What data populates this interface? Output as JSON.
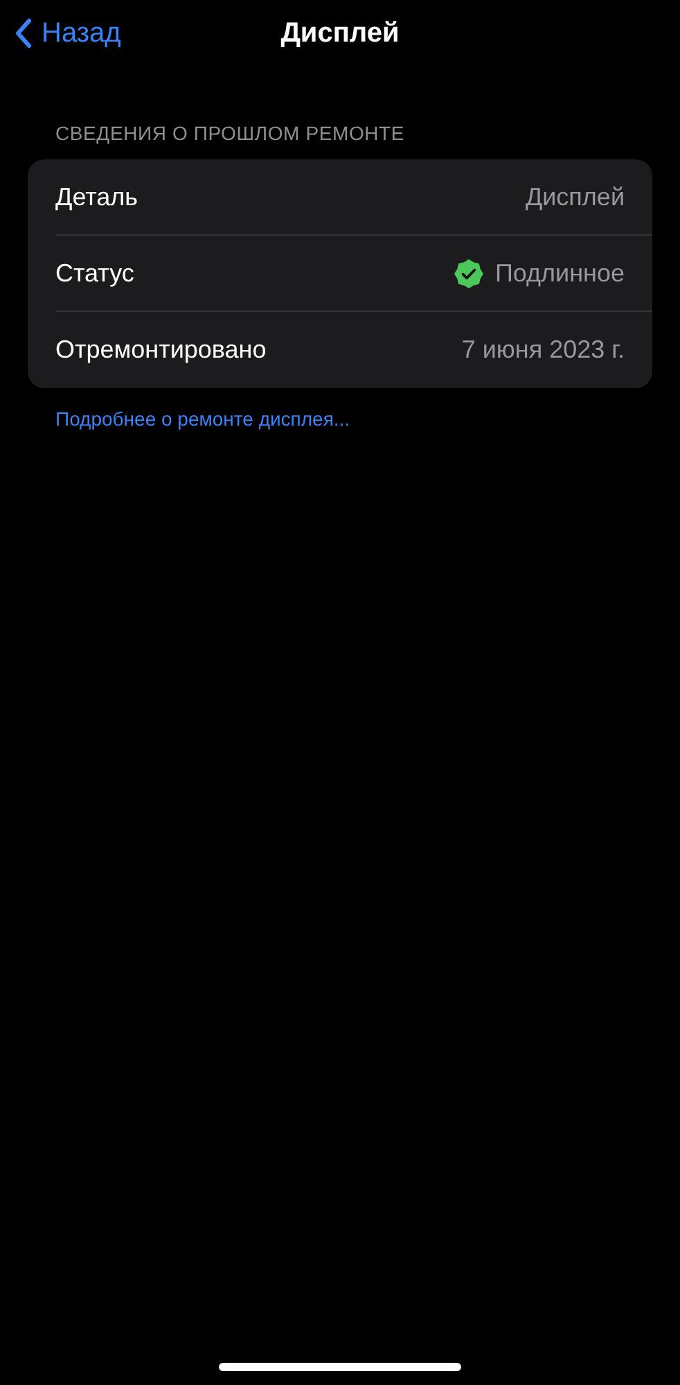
{
  "nav": {
    "back": "Назад",
    "title": "Дисплей"
  },
  "section": {
    "header": "СВЕДЕНИЯ О ПРОШЛОМ РЕМОНТЕ",
    "rows": [
      {
        "kind": "text",
        "label": "Деталь",
        "value": "Дисплей"
      },
      {
        "kind": "verified",
        "label": "Статус",
        "value": "Подлинное"
      },
      {
        "kind": "text",
        "label": "Отремонтировано",
        "value": "7 июня 2023 г."
      }
    ]
  },
  "link": "Подробнее о ремонте дисплея..."
}
